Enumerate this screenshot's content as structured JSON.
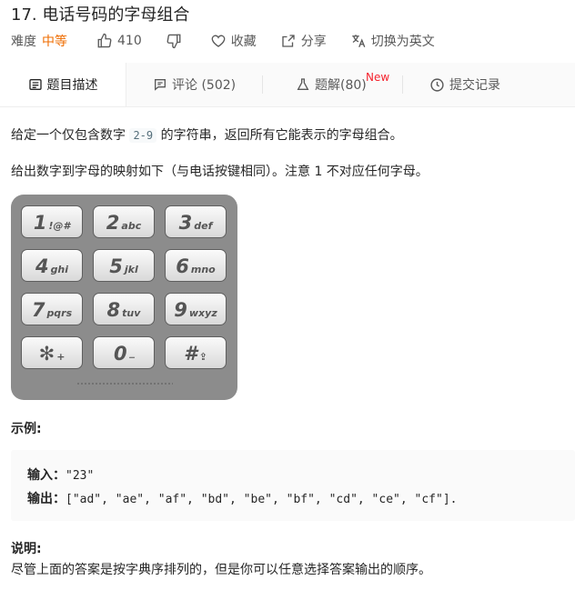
{
  "problem": {
    "title": "17. 电话号码的字母组合",
    "difficulty_label": "难度",
    "difficulty": "中等",
    "likes": "410",
    "favorite_label": "收藏",
    "share_label": "分享",
    "translate_label": "切换为英文"
  },
  "tabs": [
    {
      "label": "题目描述"
    },
    {
      "label": "评论 (502)"
    },
    {
      "label": "题解(80)",
      "badge": "New"
    },
    {
      "label": "提交记录"
    }
  ],
  "description": {
    "line1_before": "给定一个仅包含数字 ",
    "line1_code": "2-9",
    "line1_after": " 的字符串，返回所有它能表示的字母组合。",
    "line2": "给出数字到字母的映射如下（与电话按键相同）。注意 1 不对应任何字母。"
  },
  "keypad": [
    {
      "num": "1",
      "letters": "!@#"
    },
    {
      "num": "2",
      "letters": "abc"
    },
    {
      "num": "3",
      "letters": "def"
    },
    {
      "num": "4",
      "letters": "ghi"
    },
    {
      "num": "5",
      "letters": "jkl"
    },
    {
      "num": "6",
      "letters": "mno"
    },
    {
      "num": "7",
      "letters": "pqrs"
    },
    {
      "num": "8",
      "letters": "tuv"
    },
    {
      "num": "9",
      "letters": "wxyz"
    },
    {
      "num": "✻",
      "letters": "+"
    },
    {
      "num": "0",
      "letters": "⎯"
    },
    {
      "num": "#",
      "letters": "⇪"
    }
  ],
  "example": {
    "heading": "示例:",
    "input_label": "输入：",
    "input_value": "\"23\"",
    "output_label": "输出：",
    "output_value": "[\"ad\", \"ae\", \"af\", \"bd\", \"be\", \"bf\", \"cd\", \"ce\", \"cf\"]."
  },
  "note": {
    "heading": "说明:",
    "text": "尽管上面的答案是按字典序排列的，但是你可以任意选择答案输出的顺序。"
  },
  "colors": {
    "difficulty": "#ef6c00",
    "badge": "#f5222d",
    "keypad_body": "#8c8c8c"
  },
  "icons": [
    "thumb-up-icon",
    "thumb-down-icon",
    "heart-icon",
    "share-icon",
    "translate-icon",
    "description-icon",
    "comment-icon",
    "flask-icon",
    "clock-icon"
  ]
}
